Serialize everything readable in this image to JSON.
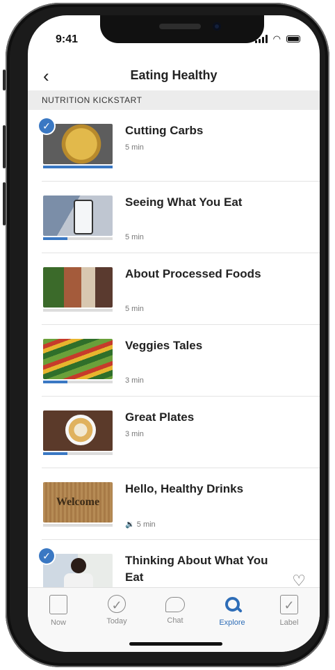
{
  "status": {
    "time": "9:41"
  },
  "header": {
    "title": "Eating Healthy"
  },
  "section": {
    "label": "NUTRITION KICKSTART"
  },
  "items": [
    {
      "title": "Cutting Carbs",
      "duration": "5 min",
      "completed": true,
      "progress": 1.0
    },
    {
      "title": "Seeing What You Eat",
      "duration": "5 min",
      "completed": false,
      "progress": 0.35
    },
    {
      "title": "About Processed Foods",
      "duration": "5 min",
      "completed": false,
      "progress": 0.0
    },
    {
      "title": "Veggies Tales",
      "duration": "3 min",
      "completed": false,
      "progress": 0.35
    },
    {
      "title": "Great Plates",
      "duration": "3 min",
      "completed": false,
      "progress": 0.35
    },
    {
      "title": "Hello, Healthy Drinks",
      "duration": "5 min",
      "completed": false,
      "progress": 0.0,
      "audio": true
    },
    {
      "title": "Thinking About What You Eat",
      "duration": "",
      "completed": true,
      "progress": 0.0,
      "favorite_icon": "heart-outline-icon"
    }
  ],
  "thumbnail_text": {
    "welcome": "Welcome"
  },
  "tabs": [
    {
      "label": "Now",
      "icon": "doc-icon",
      "active": false
    },
    {
      "label": "Today",
      "icon": "check-circle-icon",
      "active": false
    },
    {
      "label": "Chat",
      "icon": "chat-bubble-icon",
      "active": false
    },
    {
      "label": "Explore",
      "icon": "search-icon",
      "active": true
    },
    {
      "label": "Label",
      "icon": "doc-check-icon",
      "active": false
    }
  ],
  "colors": {
    "accent": "#2e6db7",
    "progress": "#3a78c3",
    "section_bg": "#ececec"
  }
}
